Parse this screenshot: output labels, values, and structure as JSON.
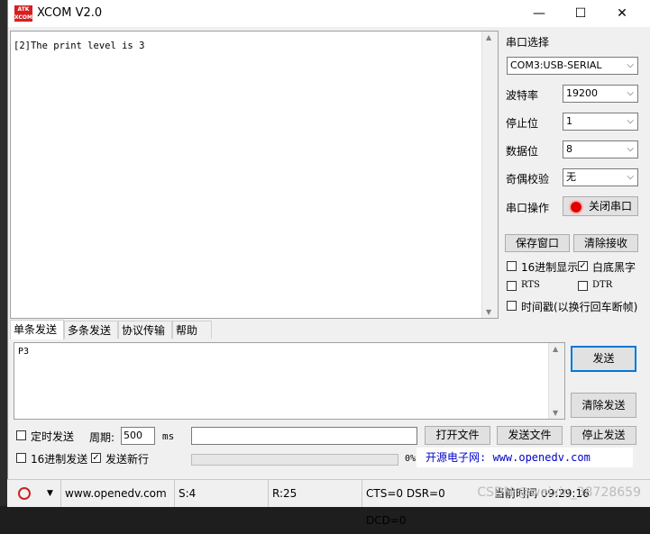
{
  "window": {
    "title": "XCOM V2.0",
    "logo_text": "ATK XCOM"
  },
  "controls": {
    "minimize": "—",
    "maximize": "☐",
    "close": "✕"
  },
  "receive": {
    "text": "[2]The print level is 3"
  },
  "serial": {
    "port_select_label": "串口选择",
    "port_value": "COM3:USB-SERIAL",
    "baud_label": "波特率",
    "baud_value": "19200",
    "stop_label": "停止位",
    "stop_value": "1",
    "data_label": "数据位",
    "data_value": "8",
    "parity_label": "奇偶校验",
    "parity_value": "无",
    "op_label": "串口操作",
    "op_button": "关闭串口"
  },
  "options": {
    "save_window": "保存窗口",
    "clear_receive": "清除接收",
    "hex_display": "16进制显示",
    "white_bg": "白底黑字",
    "rts": "RTS",
    "dtr": "DTR",
    "timestamp": "时间戳(以换行回车断帧)"
  },
  "tabs": [
    "单条发送",
    "多条发送",
    "协议传输",
    "帮助"
  ],
  "send": {
    "text": "P3",
    "send_button": "发送",
    "clear_send_button": "清除发送"
  },
  "bottom": {
    "timed_send": "定时发送",
    "period_label": "周期:",
    "period_value": "500",
    "period_unit": "ms",
    "open_file": "打开文件",
    "send_file": "发送文件",
    "stop_send": "停止发送",
    "hex_send": "16进制发送",
    "send_newline": "发送新行",
    "progress_text": "0%",
    "progress": 0,
    "url": "开源电子网: www.openedv.com"
  },
  "statusbar": {
    "website": "www.openedv.com",
    "sent": "S:4",
    "received": "R:25",
    "signals": "CTS=0 DSR=0 DCD=0",
    "time": "当前时间 09:29:16"
  },
  "watermark": "CSDN @weixin_38728659"
}
